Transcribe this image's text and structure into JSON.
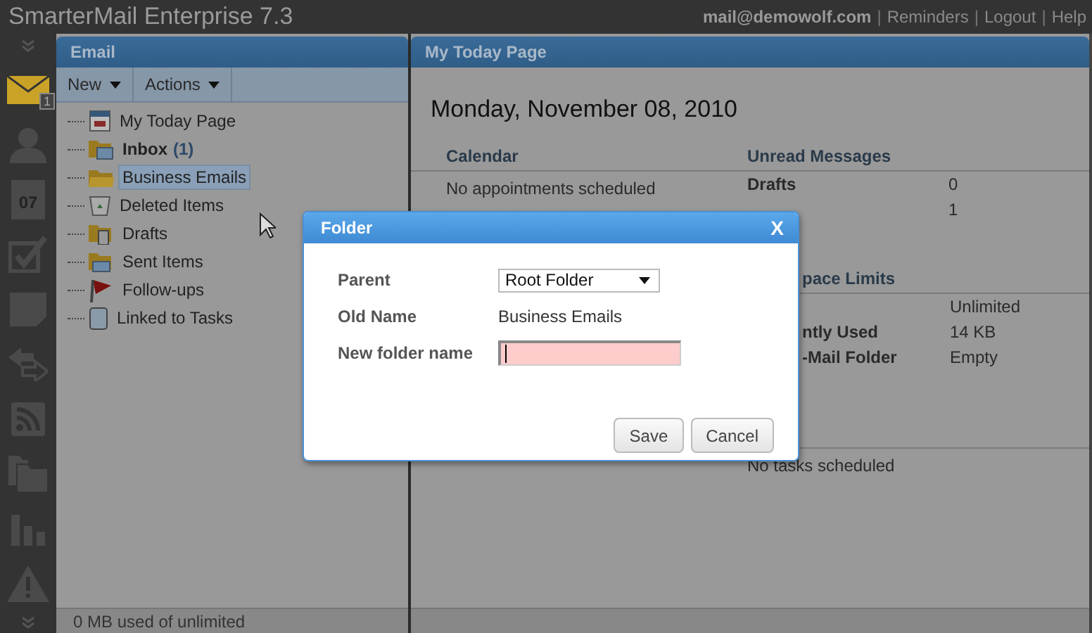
{
  "top_bar": {
    "title": "SmarterMail Enterprise 7.3",
    "links": [
      {
        "label": "mail@demowolf.com"
      },
      {
        "separator": "|",
        "label": "Reminders"
      },
      {
        "separator": "|",
        "label": "Logout"
      },
      {
        "separator": "|",
        "label": "Help"
      }
    ]
  },
  "rail": [
    {
      "kind": "mail",
      "badge": "1",
      "selected": true
    },
    {
      "kind": "contacts",
      "selected": false
    },
    {
      "kind": "calendar",
      "label": "07",
      "selected": false
    },
    {
      "kind": "tasks",
      "selected": false
    },
    {
      "kind": "notes",
      "selected": false
    },
    {
      "kind": "sync",
      "selected": false
    },
    {
      "kind": "rss",
      "selected": false
    },
    {
      "kind": "files",
      "selected": false
    },
    {
      "kind": "reports",
      "selected": false
    },
    {
      "kind": "alert",
      "selected": false
    }
  ],
  "email_panel": {
    "title": "Email",
    "toolbar": [
      "New",
      "Actions"
    ],
    "folders": [
      {
        "kind": "today",
        "label": "My Today Page",
        "selected": false,
        "unread": false
      },
      {
        "kind": "inbox",
        "label": "Inbox",
        "count": "(1)",
        "selected": false,
        "unread": true
      },
      {
        "kind": "folder",
        "label": "Business Emails",
        "selected": true,
        "unread": false
      },
      {
        "kind": "trash",
        "label": "Deleted Items",
        "selected": false,
        "unread": false
      },
      {
        "kind": "drafts",
        "label": "Drafts",
        "selected": false,
        "unread": false
      },
      {
        "kind": "sent",
        "label": "Sent Items",
        "selected": false,
        "unread": false
      },
      {
        "kind": "flag",
        "label": "Follow-ups",
        "selected": false,
        "unread": false
      },
      {
        "kind": "tasks",
        "label": "Linked to Tasks",
        "selected": false,
        "unread": false
      }
    ],
    "status": "0 MB used of unlimited"
  },
  "today_panel": {
    "title": "My Today Page",
    "date": "Monday, November 08, 2010",
    "calendar": {
      "heading": "Calendar",
      "text": "No appointments scheduled"
    },
    "unread": {
      "heading": "Unread Messages",
      "rows": [
        {
          "label": "Drafts",
          "value": "0"
        },
        {
          "value": "1"
        }
      ]
    },
    "space": {
      "heading": "pace Limits",
      "rows": [
        {
          "value": "Unlimited"
        },
        {
          "label": "ntly Used",
          "value": "14 KB"
        },
        {
          "label": "-Mail Folder",
          "value": "Empty"
        }
      ]
    },
    "tasks": {
      "text": "No tasks scheduled"
    }
  },
  "dialog": {
    "title": "Folder",
    "close": "X",
    "parent": {
      "label": "Parent",
      "value": "Root Folder"
    },
    "old_name": {
      "label": "Old Name",
      "value": "Business Emails"
    },
    "new_name": {
      "label": "New folder name",
      "focused": true
    },
    "buttons": [
      "Save",
      "Cancel"
    ]
  }
}
